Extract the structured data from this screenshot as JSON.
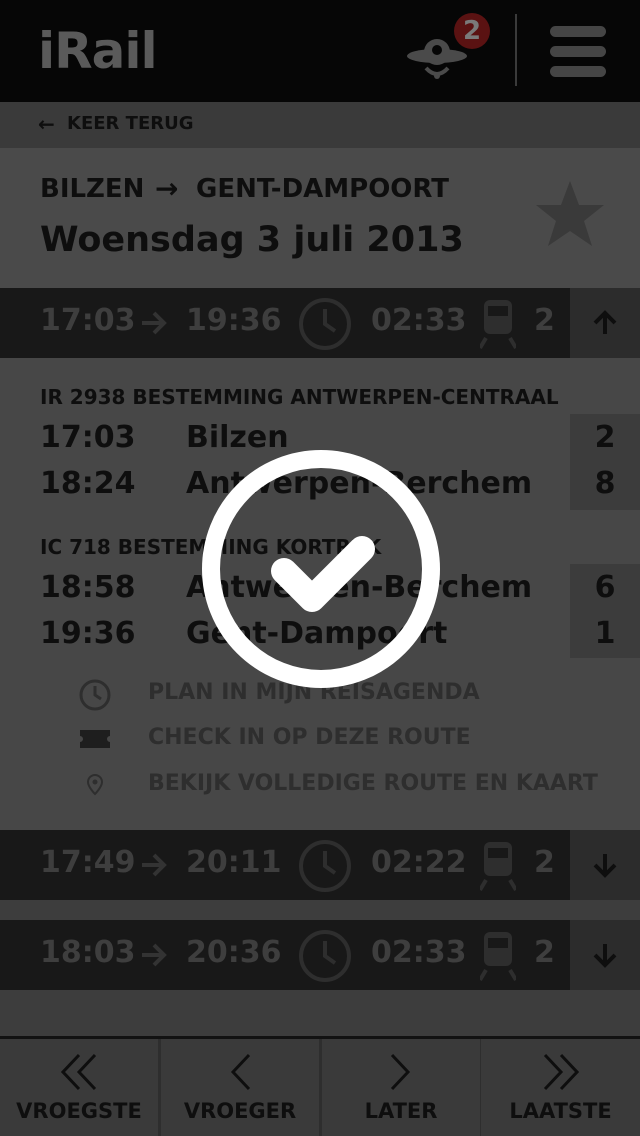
{
  "header": {
    "logo": "iRail",
    "notification_count": "2"
  },
  "back": {
    "label": "KEER TERUG"
  },
  "route": {
    "from": "BILZEN",
    "to": "GENT-DAMPOORT",
    "date": "Woensdag 3 juli 2013"
  },
  "trips": [
    {
      "depart": "17:03",
      "arrive": "19:36",
      "duration": "02:33",
      "transfers": "2",
      "expanded": true
    },
    {
      "depart": "17:49",
      "arrive": "20:11",
      "duration": "02:22",
      "transfers": "2",
      "expanded": false
    },
    {
      "depart": "18:03",
      "arrive": "20:36",
      "duration": "02:33",
      "transfers": "2",
      "expanded": false
    }
  ],
  "legs": [
    {
      "train": "IR 2938 BESTEMMING ANTWERPEN-CENTRAAL",
      "stops": [
        {
          "time": "17:03",
          "station": "Bilzen",
          "platform": "2"
        },
        {
          "time": "18:24",
          "station": "Antwerpen-Berchem",
          "platform": "8"
        }
      ]
    },
    {
      "train": "IC 718 BESTEMMING KORTRIJK",
      "stops": [
        {
          "time": "18:58",
          "station": "Antwerpen-Berchem",
          "platform": "6"
        },
        {
          "time": "19:36",
          "station": "Gent-Dampoort",
          "platform": "1"
        }
      ]
    }
  ],
  "actions": [
    {
      "label": "PLAN IN MIJN REISAGENDA",
      "icon": "clock-icon"
    },
    {
      "label": "CHECK IN OP DEZE ROUTE",
      "icon": "ticket-icon"
    },
    {
      "label": "BEKIJK VOLLEDIGE ROUTE EN KAART",
      "icon": "map-pin-icon"
    }
  ],
  "nav": {
    "earliest": "VROEGSTE",
    "earlier": "VROEGER",
    "later": "LATER",
    "latest": "LAATSTE"
  },
  "overlay": {
    "icon": "checkmark-circle-icon"
  }
}
